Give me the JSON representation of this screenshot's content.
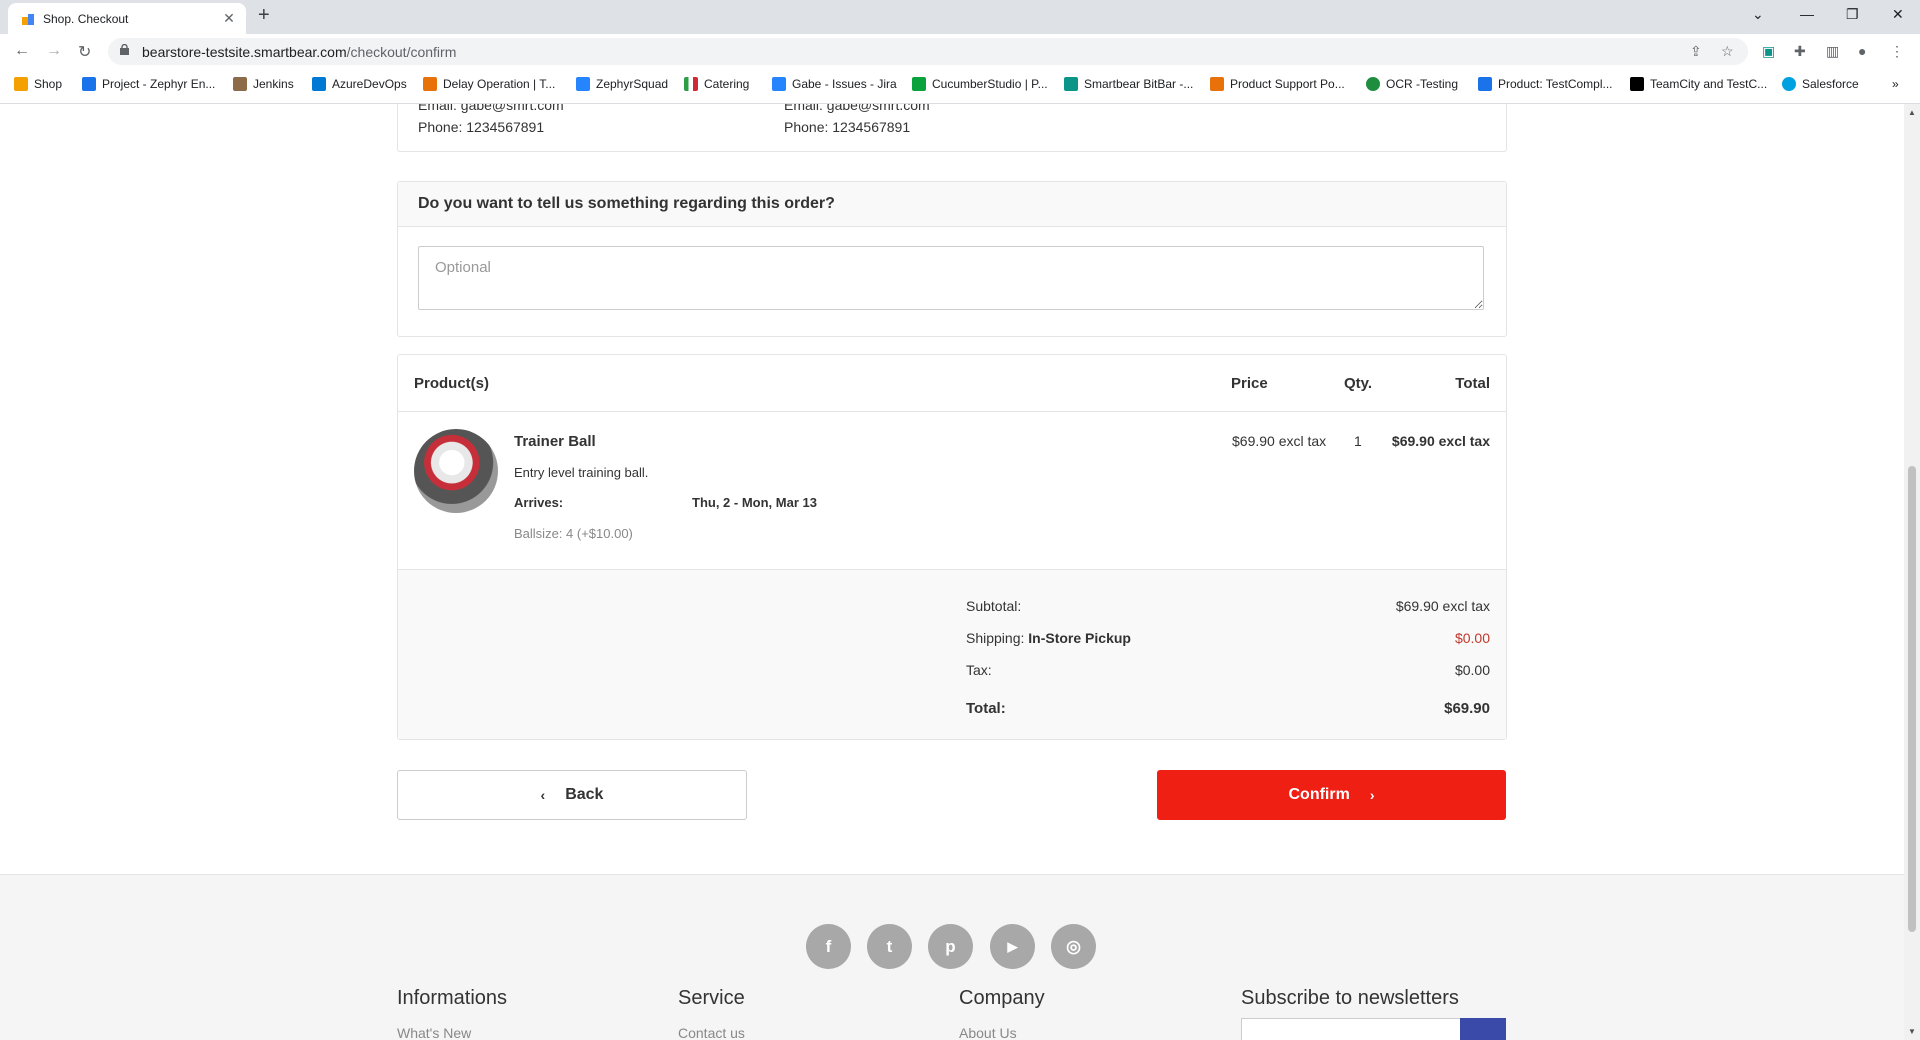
{
  "browser": {
    "tab_title": "Shop. Checkout",
    "tab_close": "✕",
    "new_tab": "+",
    "url_host": "bearstore-testsite.smartbear.com",
    "url_path": "/checkout/confirm",
    "window": {
      "minimize": "—",
      "maximize": "❐",
      "close": "✕",
      "tab_list": "⌄"
    },
    "nav": {
      "back": "←",
      "forward": "→",
      "reload": "↻"
    },
    "bookmarks": [
      {
        "label": "Shop",
        "color": "#f4a000"
      },
      {
        "label": "Project - Zephyr En...",
        "color": "#1a73e8"
      },
      {
        "label": "Jenkins",
        "color": "#8c6a4a"
      },
      {
        "label": "AzureDevOps",
        "color": "#0078d4"
      },
      {
        "label": "Delay Operation | T...",
        "color": "#e8710a"
      },
      {
        "label": "ZephyrSquad",
        "color": "#2684ff"
      },
      {
        "label": "Catering",
        "color": "#2e9e44"
      },
      {
        "label": "Gabe - Issues - Jira",
        "color": "#2684ff"
      },
      {
        "label": "CucumberStudio | P...",
        "color": "#0aa23c"
      },
      {
        "label": "Smartbear BitBar -...",
        "color": "#0d9488"
      },
      {
        "label": "Product Support Po...",
        "color": "#e8710a"
      },
      {
        "label": "OCR -Testing",
        "color": "#1e8e3e"
      },
      {
        "label": "Product: TestCompl...",
        "color": "#1a73e8"
      },
      {
        "label": "TeamCity and TestC...",
        "color": "#000000"
      },
      {
        "label": "Salesforce",
        "color": "#00a1e0"
      }
    ],
    "bookmarks_more": "»"
  },
  "address": {
    "billing_email": "Email:  gabe@smrt.com",
    "billing_phone": "Phone: 1234567891",
    "shipping_email": "Email:  gabe@smrt.com",
    "shipping_phone": "Phone: 1234567891"
  },
  "note": {
    "title": "Do you want to tell us something regarding this order?",
    "placeholder": "Optional"
  },
  "cart": {
    "headers": {
      "product": "Product(s)",
      "price": "Price",
      "qty": "Qty.",
      "total": "Total"
    },
    "item": {
      "name": "Trainer Ball",
      "description": "Entry level training ball.",
      "arrives_label": "Arrives:",
      "arrives_value": "Thu, 2 - Mon, Mar 13",
      "attribute": "Ballsize: 4 (+$10.00)",
      "price": "$69.90 excl tax",
      "qty": "1",
      "total": "$69.90 excl tax"
    },
    "totals": {
      "subtotal_label": "Subtotal:",
      "subtotal_value": "$69.90 excl tax",
      "shipping_label": "Shipping:",
      "shipping_method": "In-Store Pickup",
      "shipping_value": "$0.00",
      "tax_label": "Tax:",
      "tax_value": "$0.00",
      "total_label": "Total:",
      "total_value": "$69.90"
    }
  },
  "actions": {
    "back": "Back",
    "confirm": "Confirm"
  },
  "footer": {
    "social": [
      "f",
      "t",
      "p",
      "▶",
      "◎"
    ],
    "columns": [
      "Informations",
      "Service",
      "Company",
      "Subscribe to newsletters"
    ],
    "links": [
      "What's New",
      "Contact us",
      "About Us"
    ]
  },
  "colors": {
    "accent": "#f01f14",
    "shipping_value": "#c0392b",
    "newsletter_button": "#3a4aa8"
  }
}
